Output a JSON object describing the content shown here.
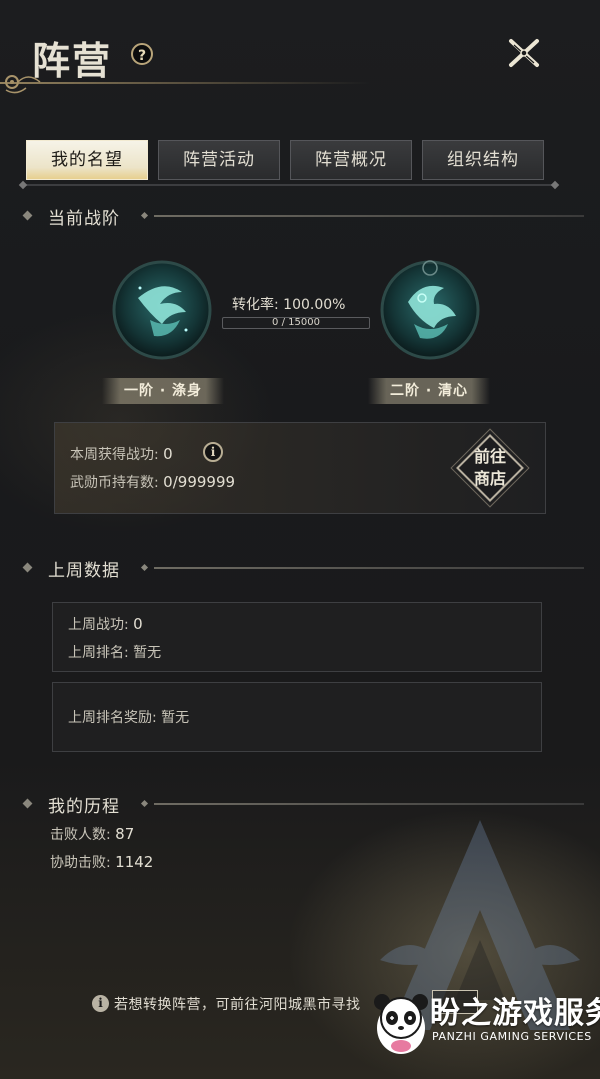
{
  "header": {
    "title": "阵营",
    "help_symbol": "?"
  },
  "tabs": [
    {
      "label": "我的名望",
      "active": true
    },
    {
      "label": "阵营活动",
      "active": false
    },
    {
      "label": "阵营概况",
      "active": false
    },
    {
      "label": "组织结构",
      "active": false
    }
  ],
  "current_rank": {
    "section_title": "当前战阶",
    "conversion_label": "转化率: 100.00%",
    "progress": {
      "text": "0 / 15000",
      "current": 0,
      "max": 15000,
      "fraction": 0.0
    },
    "rank_left": "一阶 · 涤身",
    "rank_right": "二阶 · 清心",
    "weekly_merit_label": "本周获得战功:",
    "weekly_merit_value": "0",
    "coin_label": "武勋币持有数:",
    "coin_value": "0/999999",
    "info_symbol": "i",
    "shop_button": {
      "line1": "前往",
      "line2": "商店"
    }
  },
  "last_week": {
    "section_title": "上周数据",
    "merit_label": "上周战功:",
    "merit_value": "0",
    "rank_label": "上周排名:",
    "rank_value": "暂无",
    "reward_label": "上周排名奖励:",
    "reward_value": "暂无"
  },
  "history": {
    "section_title": "我的历程",
    "kills_label": "击败人数:",
    "kills_value": "87",
    "assists_label": "协助击败:",
    "assists_value": "1142"
  },
  "footer": {
    "tip_symbol": "i",
    "tip_text": "若想转换阵营，可前往河阳城黑市寻找"
  },
  "watermark": {
    "brand_cn": "盼之游戏服务",
    "brand_en": "PANZHI GAMING SERVICES"
  },
  "colors": {
    "accent_teal": "#58a6a0",
    "active_tab": "#efe7cd",
    "gold_border": "#b9a57a"
  }
}
